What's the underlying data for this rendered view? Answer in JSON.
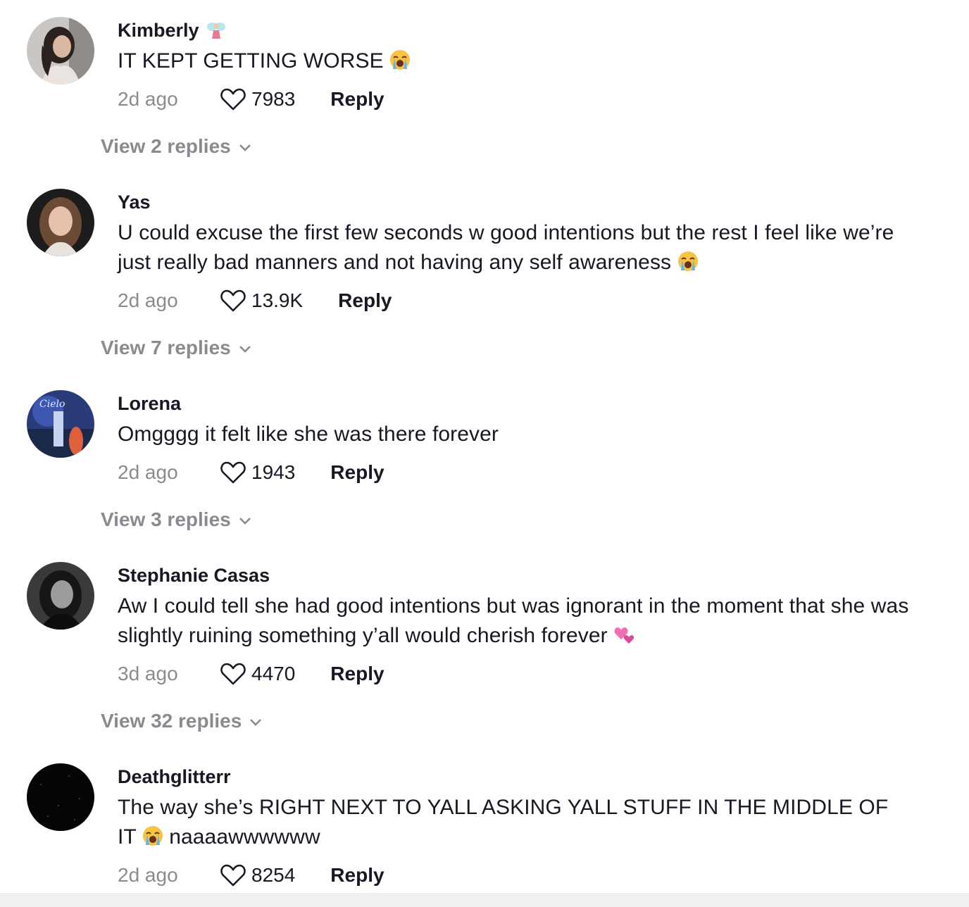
{
  "icons": {
    "like": "heart-outline-icon",
    "expand": "chevron-down-icon",
    "crying": "loudly-crying-face-emoji",
    "fairy": "fairy-emoji",
    "hearts": "revolving-hearts-emoji"
  },
  "colors": {
    "primary_text": "#161823",
    "secondary_text": "#8a8b91",
    "background": "#ffffff"
  },
  "comments": [
    {
      "username": "Kimberly",
      "text": "IT KEPT GETTING WORSE",
      "time": "2d ago",
      "likes": "7983",
      "reply_label": "Reply",
      "view_replies": "View 2 replies"
    },
    {
      "username": "Yas",
      "text": "U could excuse the first few seconds w good intentions but the rest I feel like we’re just really bad manners and not having any self awareness",
      "time": "2d ago",
      "likes": "13.9K",
      "reply_label": "Reply",
      "view_replies": "View 7 replies"
    },
    {
      "username": "Lorena",
      "text": "Omgggg it felt like she was there forever",
      "time": "2d ago",
      "likes": "1943",
      "reply_label": "Reply",
      "view_replies": "View 3 replies"
    },
    {
      "username": "Stephanie Casas",
      "text": "Aw I could tell she had good intentions but was ignorant in the moment that she was slightly ruining something y’all would cherish forever",
      "time": "3d ago",
      "likes": "4470",
      "reply_label": "Reply",
      "view_replies": "View 32 replies"
    },
    {
      "username": "Deathglitterr",
      "text_part1": "The way she’s RIGHT NEXT TO YALL ASKING YALL STUFF IN THE MIDDLE OF IT",
      "text_part2": "naaaawwwwww",
      "time": "2d ago",
      "likes": "8254",
      "reply_label": "Reply"
    }
  ]
}
